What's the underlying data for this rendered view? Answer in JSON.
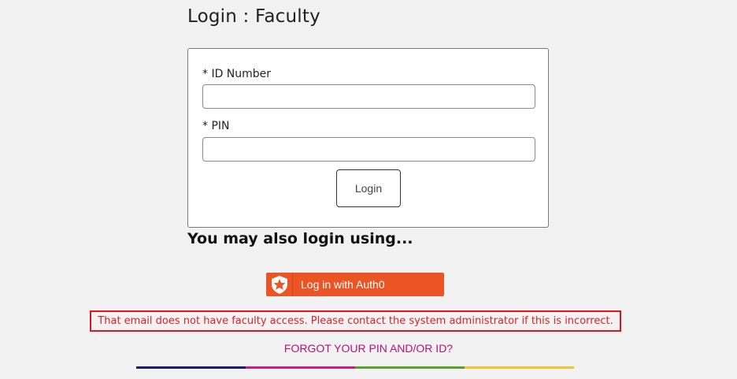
{
  "page_title": "Login : Faculty",
  "form": {
    "id_label": "* ID Number",
    "id_value": "",
    "pin_label": "* PIN",
    "pin_value": "",
    "login_label": "Login"
  },
  "alt_login": {
    "heading": "You may also login using...",
    "auth0_label": "Log in with Auth0",
    "auth0_icon": "auth0-star-shield-icon"
  },
  "error_message": "That email does not have faculty access. Please contact the system administrator if this is incorrect.",
  "forgot_link": "FORGOT YOUR PIN AND/OR ID?",
  "colors": {
    "accent_bar": [
      "#1a1a8c",
      "#d4187c",
      "#5aa02c",
      "#f2c230"
    ],
    "auth0": "#eb5424",
    "error": "#e3121b",
    "link": "#b5117b"
  }
}
